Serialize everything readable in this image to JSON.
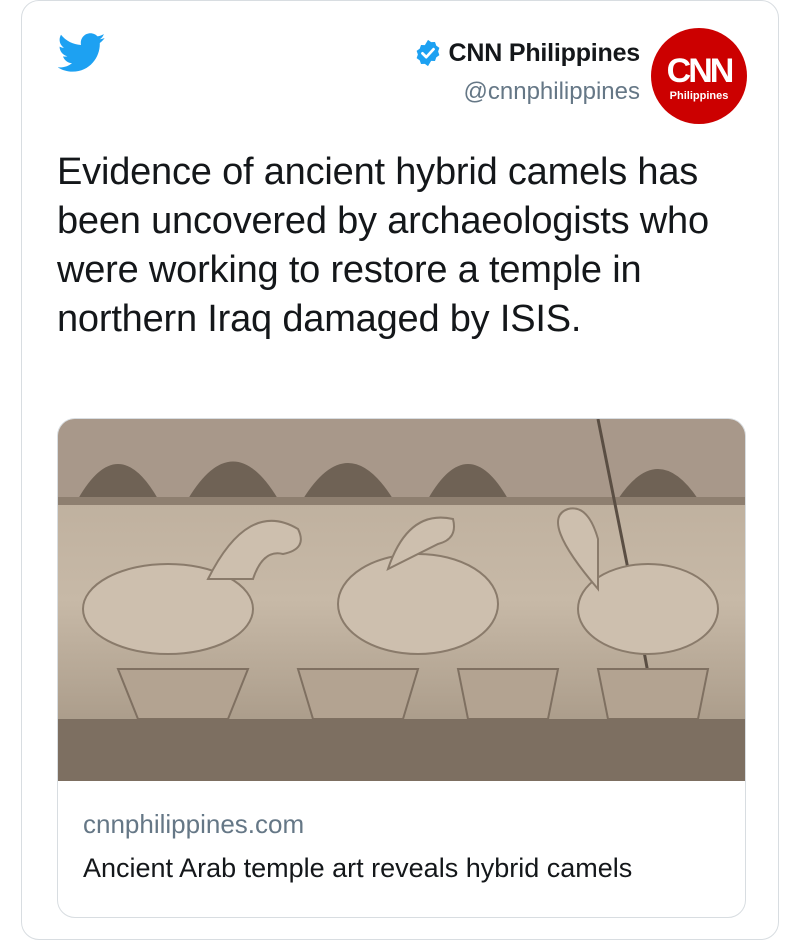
{
  "tweet": {
    "author": {
      "display_name": "CNN Philippines",
      "handle": "@cnnphilippines",
      "verified": true,
      "avatar": {
        "logo_text": "CNN",
        "sub_text": "Philippines",
        "color": "#cc0000"
      }
    },
    "text": "Evidence of ancient hybrid camels has been uncovered by archaeologists who were working to restore a temple in northern Iraq damaged by ISIS.",
    "link_card": {
      "domain": "cnnphilippines.com",
      "title": "Ancient Arab temple art reveals hybrid camels",
      "image": "stone-relief-carved-camels"
    }
  },
  "colors": {
    "twitter_blue": "#1da1f2",
    "text_primary": "#14171a",
    "text_secondary": "#657786",
    "border": "#d8dde1"
  },
  "icons": [
    "twitter-bird-icon",
    "verified-badge-icon"
  ]
}
